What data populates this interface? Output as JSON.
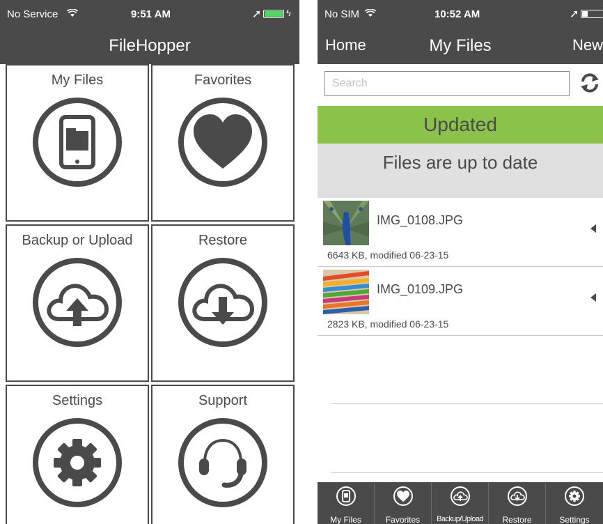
{
  "left": {
    "status": {
      "carrier": "No Service",
      "time": "9:51 AM"
    },
    "title": "FileHopper",
    "tiles": [
      {
        "label": "My Files",
        "icon": "phone-icon"
      },
      {
        "label": "Favorites",
        "icon": "heart-icon"
      },
      {
        "label": "Backup or Upload",
        "icon": "cloud-upload-icon"
      },
      {
        "label": "Restore",
        "icon": "cloud-download-icon"
      },
      {
        "label": "Settings",
        "icon": "gear-icon"
      },
      {
        "label": "Support",
        "icon": "headset-icon"
      }
    ]
  },
  "right": {
    "status": {
      "carrier": "No SIM",
      "time": "10:52 AM"
    },
    "nav": {
      "back": "Home",
      "title": "My Files",
      "action": "New"
    },
    "search": {
      "placeholder": "Search"
    },
    "banner": {
      "updated": "Updated",
      "message": "Files are up to date"
    },
    "files": [
      {
        "name": "IMG_0108.JPG",
        "meta": "6643 KB, modified 06-23-15"
      },
      {
        "name": "IMG_0109.JPG",
        "meta": "2823 KB, modified 06-23-15"
      }
    ],
    "tabs": [
      "My Files",
      "Favorites",
      "Backup/Upload",
      "Restore",
      "Settings"
    ]
  },
  "colors": {
    "bar": "#4a4a4a",
    "green": "#8bc34a",
    "gray_banner": "#e0e0e0",
    "battery": "#4cd964"
  }
}
